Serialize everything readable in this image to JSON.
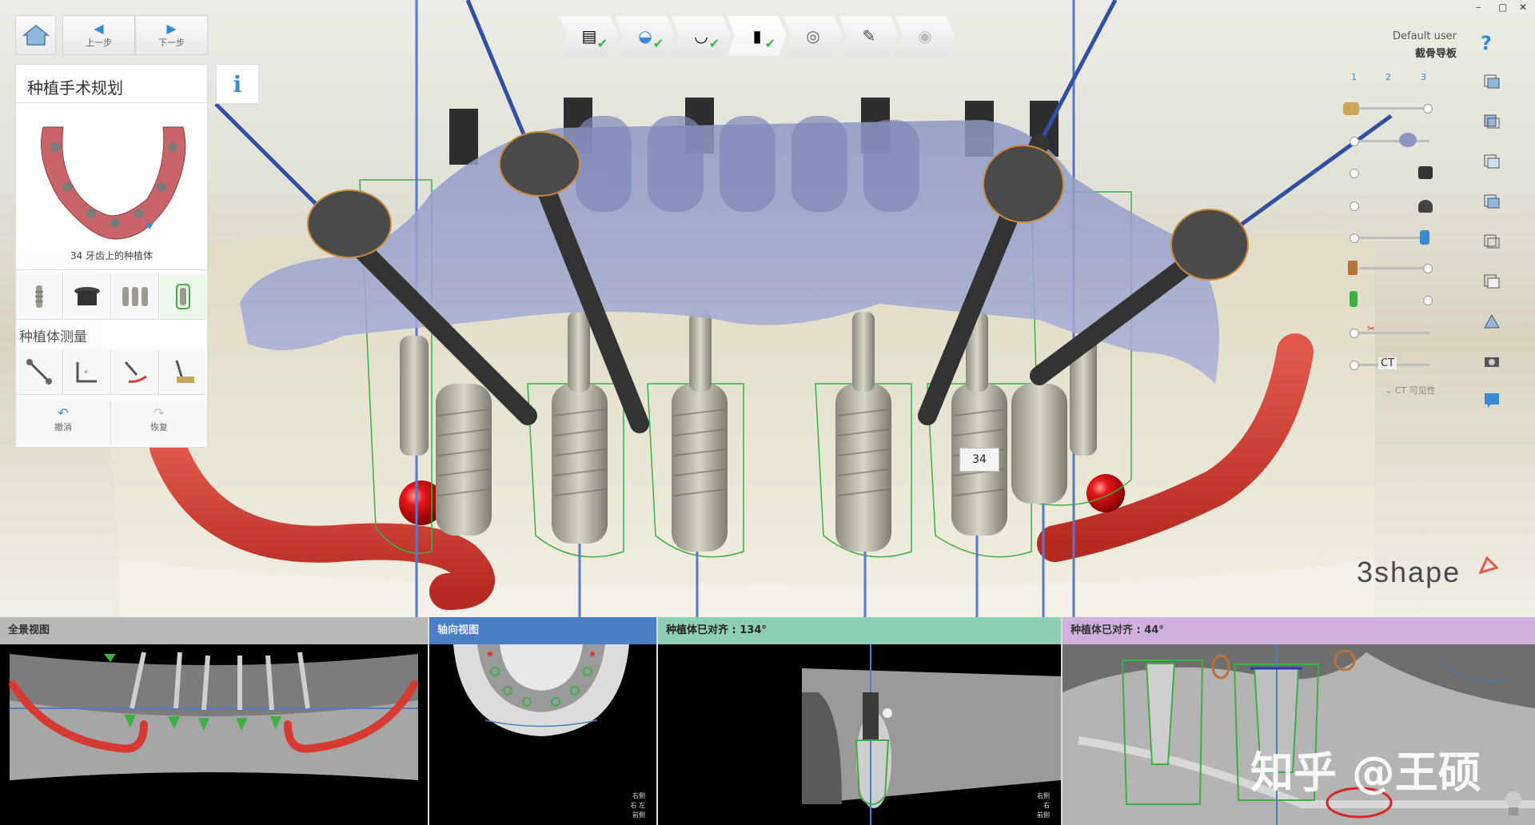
{
  "toolbar": {
    "home_icon": "home-icon",
    "back_label": "上一步",
    "next_label": "下一步"
  },
  "left_panel": {
    "title": "种植手术规划",
    "info_label": "i",
    "preview_caption": "34 牙齿上的种植体",
    "measure_title": "种植体测量",
    "undo_label": "撤消",
    "redo_label": "恢复",
    "tool_icons": [
      "implant-icon",
      "abutment-icon",
      "multi-implant-icon",
      "implant-selected-icon"
    ],
    "measure_icons": [
      "distance-measure-icon",
      "angle-measure-icon",
      "curve-measure-icon",
      "bone-measure-icon"
    ]
  },
  "workflow": {
    "steps": [
      {
        "icon": "patient-card-icon",
        "done": true
      },
      {
        "icon": "scan-import-icon",
        "done": true
      },
      {
        "icon": "jaw-align-icon",
        "done": true
      },
      {
        "icon": "implant-plan-icon",
        "done": true
      },
      {
        "icon": "sleeve-icon",
        "done": false
      },
      {
        "icon": "guide-design-icon",
        "done": false
      },
      {
        "icon": "export-disc-icon",
        "done": false
      }
    ]
  },
  "window_controls": {
    "minimize": "–",
    "restore": "▢",
    "close": "✕"
  },
  "user": {
    "name": "Default user",
    "mode": "截骨导板",
    "help": "?"
  },
  "visibility": {
    "columns": [
      "1",
      "2",
      "3"
    ],
    "ct_label": "CT",
    "ct_visibility_label": "CT 可见性"
  },
  "brand": {
    "logo_text": "3shape"
  },
  "scene": {
    "implant_label": "34"
  },
  "bottom": {
    "panorama_title": "全景视图",
    "axial_title": "轴向视图",
    "cross1_title": "种植体已对齐 : 134°",
    "cross2_title": "种植体已对齐 : 44°",
    "orient_labels": [
      "右侧",
      "右",
      "左",
      "前侧",
      "前侧"
    ],
    "watermark": "知乎 @王硕"
  },
  "colors": {
    "panorama_head": "#b8b8b8",
    "axial_head": "#4a7fc4",
    "cross1_head": "#8fcfb3",
    "cross2_head": "#d0b0dc",
    "nerve": "#d63a32",
    "guide_green": "#3cb043",
    "brand_red": "#e2574c"
  }
}
